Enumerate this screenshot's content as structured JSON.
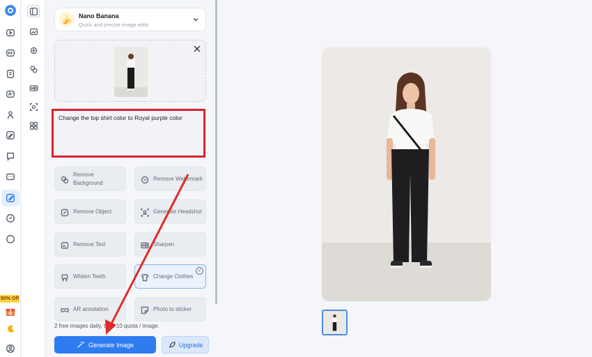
{
  "rail": {
    "promo": "50% Off"
  },
  "model": {
    "name": "Nano Banana",
    "subtitle": "Quick and precise image edits"
  },
  "prompt": {
    "text": "Change the top shirt color to Royal purple color"
  },
  "tools": [
    {
      "label": "Remove Background",
      "icon": "remove-background-icon"
    },
    {
      "label": "Remove Watermark",
      "icon": "remove-watermark-icon"
    },
    {
      "label": "Remove Object",
      "icon": "remove-object-icon"
    },
    {
      "label": "Generate Headshot",
      "icon": "headshot-icon"
    },
    {
      "label": "Remove Text",
      "icon": "remove-text-icon"
    },
    {
      "label": "Sharpen",
      "icon": "hd-icon"
    },
    {
      "label": "Whiten Teeth",
      "icon": "tooth-icon"
    },
    {
      "label": "Change Clothes",
      "icon": "shirt-icon",
      "selected": true
    },
    {
      "label": "AR annotation",
      "icon": "vr-glasses-icon"
    },
    {
      "label": "Photo to sticker",
      "icon": "sticker-icon"
    }
  ],
  "footer": {
    "note": "2 free images daily, then 10 quota / image.",
    "generate_label": "Generate Image",
    "upgrade_label": "Upgrade"
  },
  "colors": {
    "accent": "#2f7cf0",
    "highlight_box": "#d8222f",
    "arrow": "#e02a2a"
  }
}
